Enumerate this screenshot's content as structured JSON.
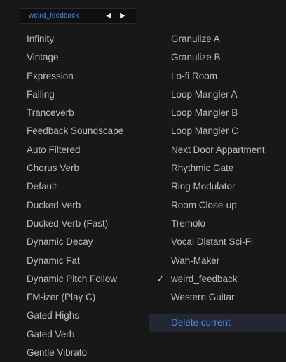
{
  "header": {
    "preset_name": "weird_feedback",
    "prev_glyph": "◀",
    "next_glyph": "▶"
  },
  "left_items": [
    "Infinity",
    "Vintage",
    "Expression",
    "Falling",
    "Tranceverb",
    "Feedback Soundscape",
    "Auto Filtered",
    "Chorus Verb",
    "Default",
    "Ducked Verb",
    "Ducked Verb (Fast)",
    "Dynamic Decay",
    "Dynamic Fat",
    "Dynamic Pitch Follow",
    "FM-izer (Play C)",
    "Gated Highs",
    "Gated Verb",
    "Gentle Vibrato"
  ],
  "right_items": [
    "Granulize A",
    "Granulize B",
    "Lo-fi Room",
    "Loop Mangler A",
    "Loop Mangler B",
    "Loop Mangler C",
    "Next Door Appartment",
    "Rhythmic Gate",
    "Ring Modulator",
    "Room Close-up",
    "Tremolo",
    "Vocal Distant Sci-Fi",
    "Wah-Maker",
    "weird_feedback",
    "Western Guitar"
  ],
  "selected_item": "weird_feedback",
  "check_glyph": "✓",
  "delete_label": "Delete current",
  "colors": {
    "background": "#181818",
    "item_text": "#bdbdbd",
    "accent_blue": "#4b8cf2",
    "delete_highlight": "#222733"
  }
}
